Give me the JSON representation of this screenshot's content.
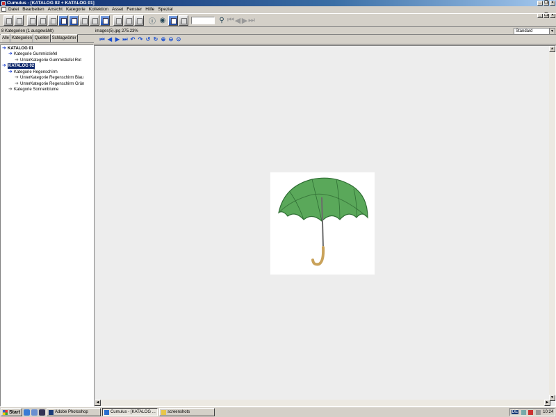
{
  "window": {
    "title": "Cumulus - [KATALOG 02 + KATALOG 01]"
  },
  "menu": [
    "Datei",
    "Bearbeiten",
    "Ansicht",
    "Kategorie",
    "Kollektion",
    "Asset",
    "Fenster",
    "Hilfe",
    "Spezial"
  ],
  "left": {
    "info": "8 Kategorien (1 ausgewählt)",
    "tabs": [
      "Alle",
      "Kategorien",
      "Quellen",
      "Schlagwörter"
    ],
    "tree": [
      {
        "label": "KATALOG 01"
      },
      {
        "label": "Kategorie Gummistiefel"
      },
      {
        "label": "UnterKategorie Gummistiefel Rot"
      },
      {
        "label": "KATALOG 02"
      },
      {
        "label": "Kategorie Regenschirm"
      },
      {
        "label": "UnterKategorie Regenschirm Blau"
      },
      {
        "label": "UnterKategorie Regenschirm Grün"
      },
      {
        "label": "Kategorie Sonnenblume"
      }
    ]
  },
  "viewer": {
    "filename": "images(5).jpg 275.23%",
    "view_mode": "Standard"
  },
  "taskbar": {
    "start": "Start",
    "tasks": [
      "Adobe Photoshop",
      "Cumulus - [KATALOG ...",
      "screenshots"
    ],
    "lang": "DE",
    "clock": "10:24"
  },
  "colors": {
    "titlebar": "#0a246a",
    "selection": "#0a246a",
    "tree_arrow_open": "#1a3fd0",
    "umbrella_green": "#5aa85a"
  }
}
